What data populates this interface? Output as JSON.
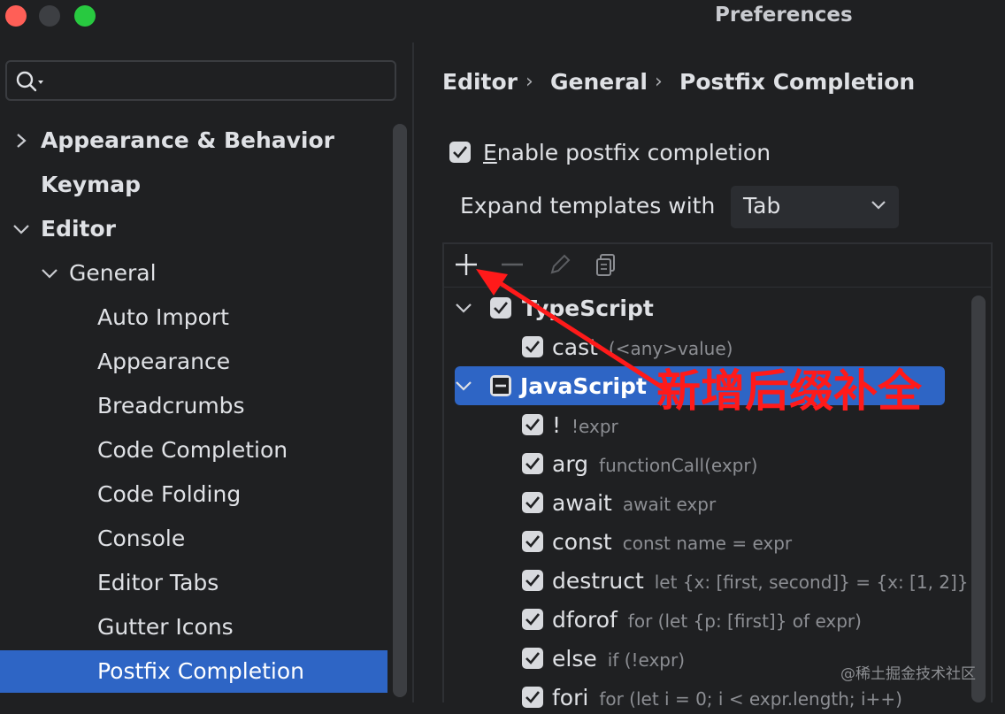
{
  "window": {
    "title": "Preferences",
    "traffic_colors": {
      "close": "#ff5f57",
      "minimize": "#3d3f43",
      "maximize": "#28c940"
    }
  },
  "search": {
    "icon": "search-icon",
    "value": ""
  },
  "sidebar": {
    "items": [
      {
        "label": "Appearance & Behavior",
        "expander": "chevron-right-icon"
      },
      {
        "label": "Keymap"
      },
      {
        "label": "Editor",
        "expander": "chevron-down-icon"
      },
      {
        "label": "General",
        "expander": "chevron-down-icon"
      },
      {
        "label": "Auto Import"
      },
      {
        "label": "Appearance"
      },
      {
        "label": "Breadcrumbs"
      },
      {
        "label": "Code Completion"
      },
      {
        "label": "Code Folding"
      },
      {
        "label": "Console"
      },
      {
        "label": "Editor Tabs"
      },
      {
        "label": "Gutter Icons"
      },
      {
        "label": "Postfix Completion",
        "selected": true
      }
    ]
  },
  "breadcrumb": {
    "items": [
      "Editor",
      "General",
      "Postfix Completion"
    ],
    "separator": "›"
  },
  "settings": {
    "enable_label_first": "E",
    "enable_label_rest": "nable postfix completion",
    "enable_checked": true,
    "expand_label": "Expand templates with",
    "expand_value": "Tab"
  },
  "toolbar": {
    "icons": [
      "add-icon",
      "remove-icon",
      "edit-icon",
      "copy-icon"
    ]
  },
  "templates": {
    "typescript": {
      "label": "TypeScript",
      "checked": true
    },
    "typescript_items": [
      {
        "key": "cast",
        "example": "(<any>value)"
      }
    ],
    "javascript": {
      "label": "JavaScript",
      "state": "partial"
    },
    "javascript_items": [
      {
        "key": "!",
        "example": "!expr"
      },
      {
        "key": "arg",
        "example": "functionCall(expr)"
      },
      {
        "key": "await",
        "example": "await expr"
      },
      {
        "key": "const",
        "example": "const name = expr"
      },
      {
        "key": "destruct",
        "example": "let {x: [first, second]} = {x: [1, 2]}"
      },
      {
        "key": "dforof",
        "example": "for (let {p: [first]} of expr)"
      },
      {
        "key": "else",
        "example": "if (!expr)"
      },
      {
        "key": "fori",
        "example": "for (let i = 0; i < expr.length; i++)"
      }
    ]
  },
  "annotation": {
    "text": "新增后缀补全",
    "color": "#ff1a1a"
  },
  "watermark": {
    "text": "@稀土掘金技术社区"
  },
  "colors": {
    "accent": "#2e65c5",
    "background": "#1f2022"
  }
}
